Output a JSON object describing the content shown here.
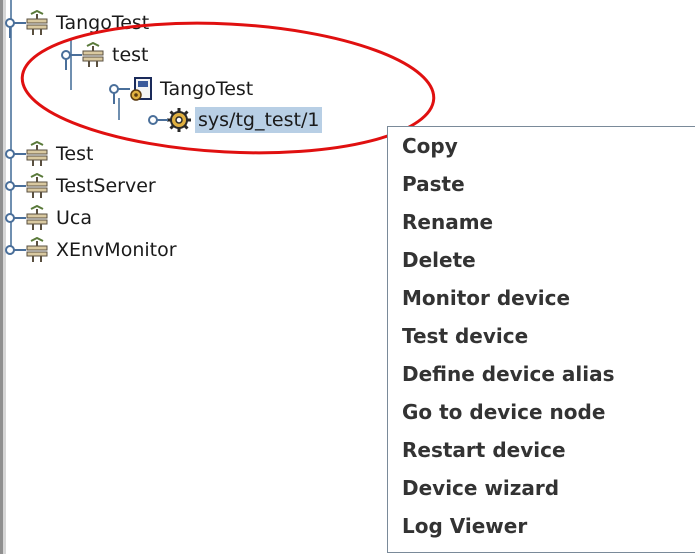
{
  "tree": {
    "nodes": [
      {
        "label": "TangoTest",
        "icon": "server-icon"
      },
      {
        "label": "test",
        "icon": "server-icon"
      },
      {
        "label": "TangoTest",
        "icon": "device-class-icon"
      },
      {
        "label": "sys/tg_test/1",
        "icon": "device-gear-icon",
        "selected": true
      },
      {
        "label": "Test",
        "icon": "server-icon"
      },
      {
        "label": "TestServer",
        "icon": "server-icon"
      },
      {
        "label": "Uca",
        "icon": "server-icon"
      },
      {
        "label": "XEnvMonitor",
        "icon": "server-icon"
      }
    ]
  },
  "context_menu": {
    "items": [
      {
        "label": "Copy"
      },
      {
        "label": "Paste"
      },
      {
        "label": "Rename"
      },
      {
        "label": "Delete"
      },
      {
        "label": "Monitor device"
      },
      {
        "label": "Test device"
      },
      {
        "label": "Define device alias"
      },
      {
        "label": "Go to device node"
      },
      {
        "label": "Restart device"
      },
      {
        "label": "Device wizard"
      },
      {
        "label": "Log Viewer"
      }
    ]
  },
  "colors": {
    "selection": "#b8cfe5",
    "annotation_ring": "#e01010",
    "tree_line": "#6f8fb0"
  }
}
